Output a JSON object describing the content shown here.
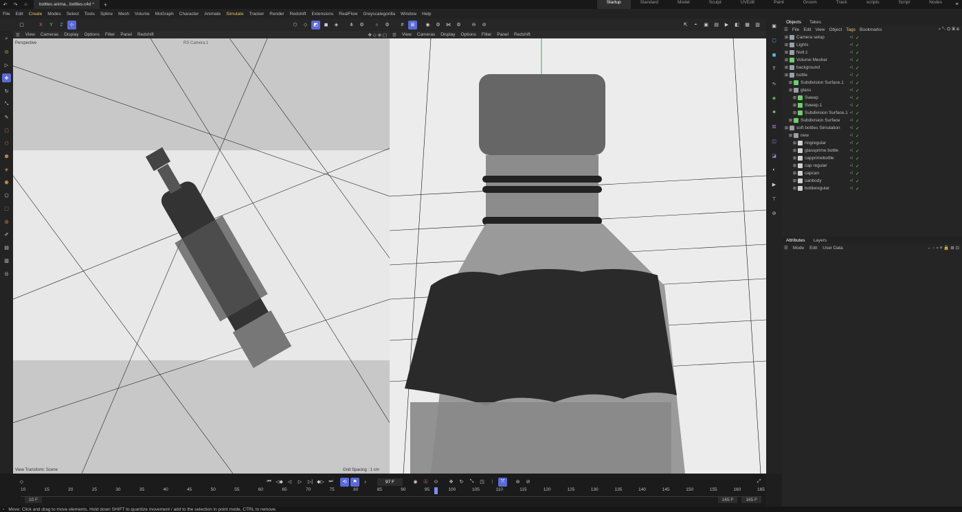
{
  "titlebar": {
    "file_tab": "bottles anima...bottles.c4d *",
    "plus": "+",
    "workspaces": [
      "Startup",
      "Standard",
      "Model",
      "Sculpt",
      "UVEdit",
      "Paint",
      "Groom",
      "Track",
      "scripts",
      "Script",
      "Nodes"
    ]
  },
  "menu": [
    "File",
    "Edit",
    "Create",
    "Modes",
    "Select",
    "Tools",
    "Spline",
    "Mesh",
    "Volume",
    "MoGraph",
    "Character",
    "Animate",
    "Simulate",
    "Tracker",
    "Render",
    "Redshift",
    "Extensions",
    "RealFlow",
    "Greyscalegorilla",
    "Window",
    "Help"
  ],
  "axes": {
    "x": "X",
    "y": "Y",
    "z": "Z"
  },
  "viewport_menu": [
    "View",
    "Cameras",
    "Display",
    "Options",
    "Filter",
    "Panel",
    "Redshift"
  ],
  "left_viewport": {
    "name": "Perspective",
    "camera": "RS Camera.1",
    "footer_left": "View Transform: Scene",
    "footer_right": "Grid Spacing : 1 cm"
  },
  "panels": {
    "objects_tab": "Objects",
    "takes_tab": "Takes",
    "attributes_tab": "Attributes",
    "layers_tab": "Layers"
  },
  "objects_menu": [
    "File",
    "Edit",
    "View",
    "Object",
    "Tags",
    "Bookmarks"
  ],
  "objects": [
    {
      "name": "Camera setup",
      "indent": 0,
      "color": "#9aa0a6"
    },
    {
      "name": "Lights",
      "indent": 0,
      "color": "#9aa0a6"
    },
    {
      "name": "Null.1",
      "indent": 0,
      "color": "#9aa0a6"
    },
    {
      "name": "Volume Mesher",
      "indent": 0,
      "color": "#6dcf6d"
    },
    {
      "name": "background",
      "indent": 0,
      "color": "#9aa0a6"
    },
    {
      "name": "bottle",
      "indent": 0,
      "color": "#9aa0a6"
    },
    {
      "name": "Subdivision Surface.1",
      "indent": 1,
      "color": "#6dcf6d"
    },
    {
      "name": "glass",
      "indent": 1,
      "color": "#9aa0a6"
    },
    {
      "name": "Sweep",
      "indent": 2,
      "color": "#6dcf6d"
    },
    {
      "name": "Sweep.1",
      "indent": 2,
      "color": "#6dcf6d"
    },
    {
      "name": "Subdivision Surface.1",
      "indent": 2,
      "color": "#6dcf6d"
    },
    {
      "name": "Subdivision Surface",
      "indent": 1,
      "color": "#6dcf6d"
    },
    {
      "name": "soft bottles Simulation",
      "indent": 0,
      "color": "#9aa0a6"
    },
    {
      "name": "new",
      "indent": 1,
      "color": "#9aa0a6"
    },
    {
      "name": "ringregular",
      "indent": 2,
      "color": "#d0d0d0"
    },
    {
      "name": "glassprime bottle",
      "indent": 2,
      "color": "#d0d0d0"
    },
    {
      "name": "capprimebottle",
      "indent": 2,
      "color": "#d0d0d0"
    },
    {
      "name": "cap regular",
      "indent": 2,
      "color": "#d0d0d0"
    },
    {
      "name": "capcan",
      "indent": 2,
      "color": "#d0d0d0"
    },
    {
      "name": "canbody",
      "indent": 2,
      "color": "#d0d0d0"
    },
    {
      "name": "bottleregular",
      "indent": 2,
      "color": "#d0d0d0"
    }
  ],
  "attributes_menu": [
    "Mode",
    "Edit",
    "User Data"
  ],
  "timeline": {
    "current_frame": "97 F",
    "start": "10 F",
    "end_a": "165 F",
    "end_b": "165 F",
    "ticks": [
      "10",
      "15",
      "20",
      "25",
      "30",
      "35",
      "40",
      "45",
      "50",
      "55",
      "60",
      "65",
      "70",
      "75",
      "80",
      "85",
      "90",
      "95",
      "100",
      "105",
      "110",
      "115",
      "120",
      "125",
      "130",
      "135",
      "140",
      "145",
      "150",
      "155",
      "160",
      "165"
    ]
  },
  "status": "Move: Click and drag to move elements. Hold down SHIFT to quantize movement / add to the selection in point mode, CTRL to remove."
}
